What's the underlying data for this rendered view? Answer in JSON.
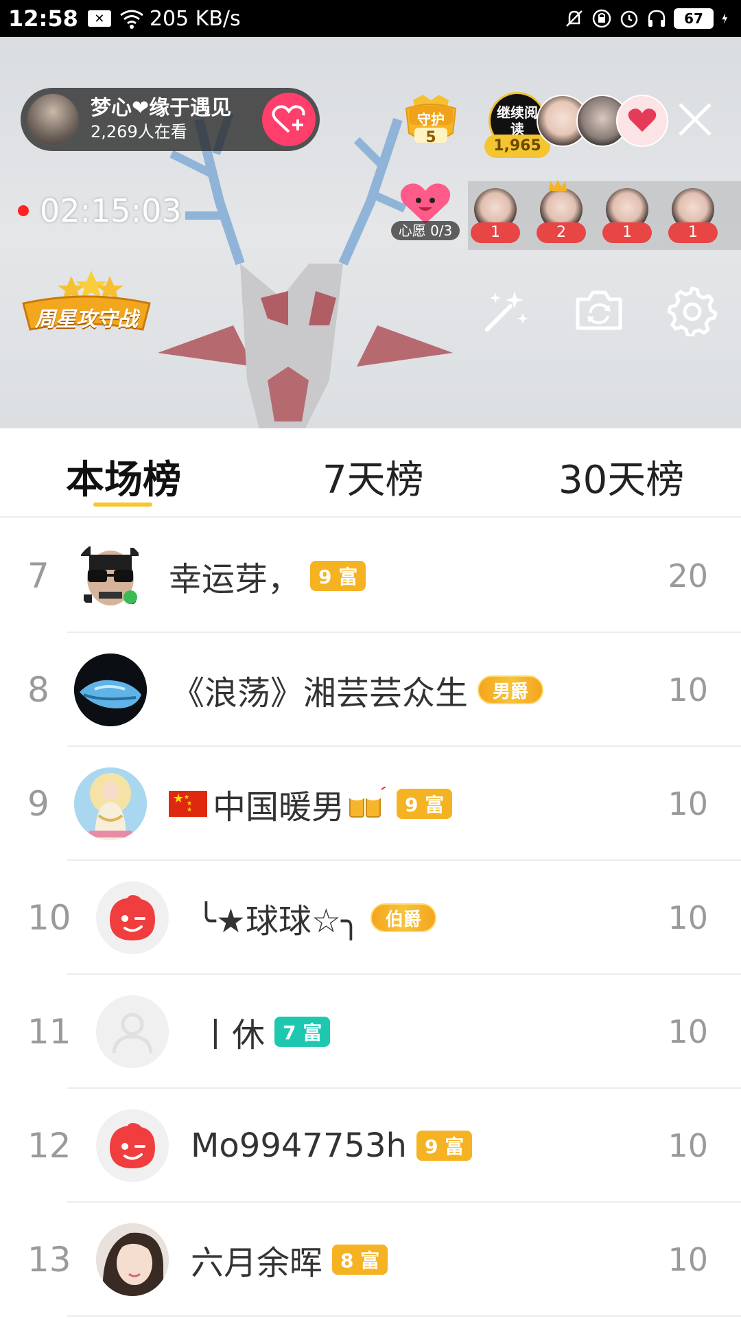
{
  "status_bar": {
    "time": "12:58",
    "speed": "205 KB/s",
    "battery": "67"
  },
  "live": {
    "anchor_name": "梦心❤缘于遇见",
    "viewers": "2,269人在看",
    "guard_label": "守护",
    "guard_count": "5",
    "read_badge": "继续阅读",
    "coin_count": "1,965",
    "timer": "02:15:03",
    "wish_label": "心愿 0/3",
    "fans": [
      {
        "count": "1"
      },
      {
        "count": "2"
      },
      {
        "count": "1"
      },
      {
        "count": "1"
      }
    ],
    "week_badge": "周星攻守战"
  },
  "tabs": [
    {
      "label": "本场榜"
    },
    {
      "label": "7天榜"
    },
    {
      "label": "30天榜"
    }
  ],
  "ranking": [
    {
      "rank": "7",
      "name": "幸运芽，",
      "badge": "9 富",
      "badge_color": "#f5b324",
      "score": "20"
    },
    {
      "rank": "8",
      "name": "《浪荡》湘芸芸众生",
      "noble": "男爵",
      "score": "10"
    },
    {
      "rank": "9",
      "name": "中国暖男",
      "badge": "9 富",
      "badge_color": "#f5b324",
      "score": "10"
    },
    {
      "rank": "10",
      "name": "╰★球球☆╮",
      "noble": "伯爵",
      "score": "10"
    },
    {
      "rank": "11",
      "name": "丨休",
      "badge": "7 富",
      "badge_color": "#1ec8b0",
      "score": "10"
    },
    {
      "rank": "12",
      "name": "Mo9947753h",
      "badge": "9 富",
      "badge_color": "#f5b324",
      "score": "10"
    },
    {
      "rank": "13",
      "name": "六月余晖",
      "badge": "8 富",
      "badge_color": "#f5b324",
      "score": "10"
    }
  ]
}
